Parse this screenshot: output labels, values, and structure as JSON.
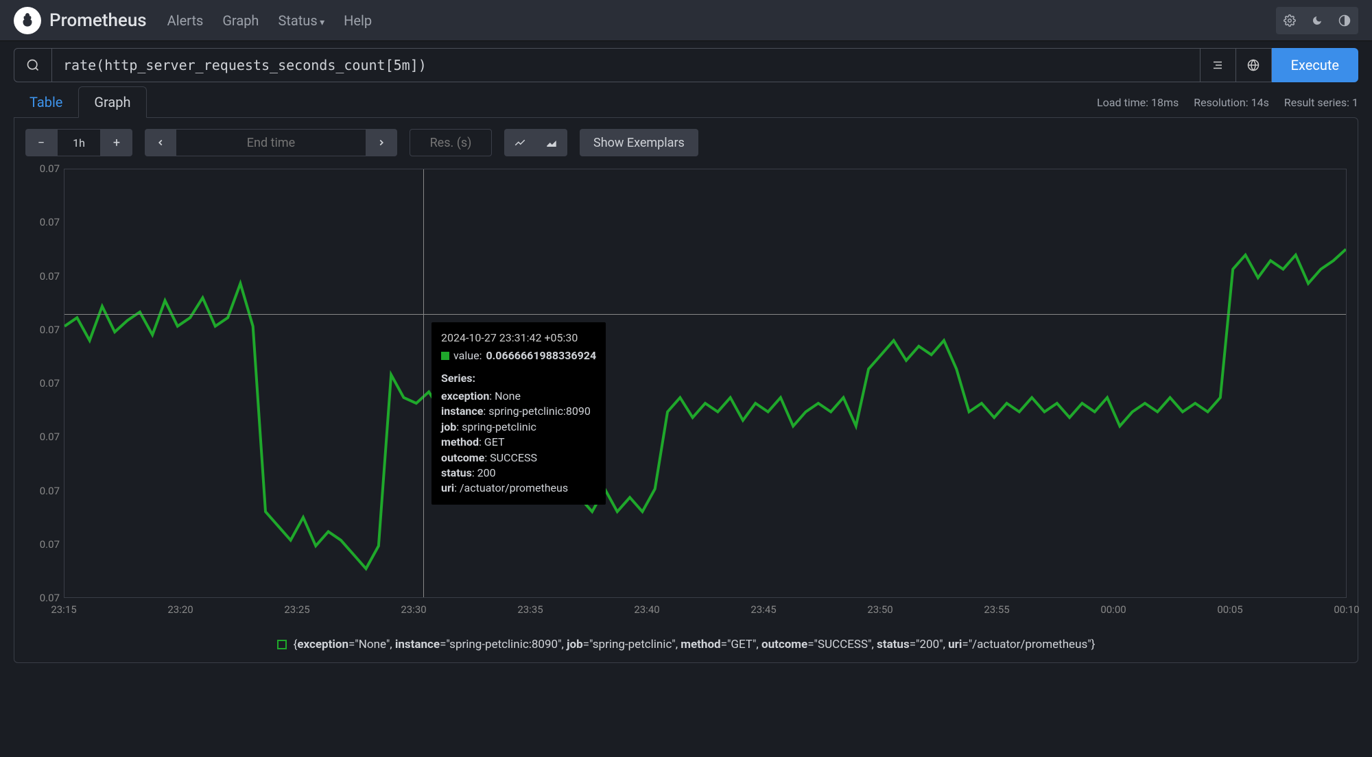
{
  "app": {
    "brand": "Prometheus",
    "nav": [
      "Alerts",
      "Graph",
      "Status",
      "Help"
    ]
  },
  "query": {
    "expression": "rate(http_server_requests_seconds_count[5m])",
    "execute_label": "Execute"
  },
  "stats": {
    "load_time": "Load time: 18ms",
    "resolution": "Resolution: 14s",
    "result_series": "Result series: 1"
  },
  "tabs": {
    "table": "Table",
    "graph": "Graph"
  },
  "toolbar": {
    "range": "1h",
    "endtime_placeholder": "End time",
    "res_placeholder": "Res. (s)",
    "show_exemplars": "Show Exemplars"
  },
  "chart_data": {
    "type": "line",
    "title": "",
    "xlabel": "",
    "ylabel": "",
    "ylim": [
      0.06,
      0.075
    ],
    "y_ticks": [
      "0.07",
      "0.07",
      "0.07",
      "0.07",
      "0.07",
      "0.07",
      "0.07",
      "0.07",
      "0.07"
    ],
    "x_ticks": [
      "23:15",
      "23:20",
      "23:25",
      "23:30",
      "23:35",
      "23:40",
      "23:45",
      "23:50",
      "23:55",
      "00:00",
      "00:05",
      "00:10"
    ],
    "series": [
      {
        "name": "{exception=\"None\", instance=\"spring-petclinic:8090\", job=\"spring-petclinic\", method=\"GET\", outcome=\"SUCCESS\", status=\"200\", uri=\"/actuator/prometheus\"}",
        "color": "#1fa82b",
        "values": [
          0.0695,
          0.0698,
          0.069,
          0.0702,
          0.0693,
          0.0697,
          0.07,
          0.0692,
          0.0704,
          0.0695,
          0.0698,
          0.0705,
          0.0695,
          0.0698,
          0.071,
          0.0695,
          0.063,
          0.0625,
          0.062,
          0.0628,
          0.0618,
          0.0623,
          0.062,
          0.0615,
          0.061,
          0.0618,
          0.0678,
          0.067,
          0.0668,
          0.0672,
          0.0665,
          0.067,
          0.0668,
          0.0665,
          0.067,
          0.066,
          0.0665,
          0.0668,
          0.066,
          0.0665,
          0.0655,
          0.0635,
          0.063,
          0.0638,
          0.063,
          0.0635,
          0.063,
          0.0638,
          0.0665,
          0.067,
          0.0663,
          0.0668,
          0.0665,
          0.067,
          0.0662,
          0.0668,
          0.0665,
          0.067,
          0.066,
          0.0665,
          0.0668,
          0.0665,
          0.067,
          0.066,
          0.068,
          0.0685,
          0.069,
          0.0683,
          0.0688,
          0.0685,
          0.069,
          0.068,
          0.0665,
          0.0668,
          0.0663,
          0.0668,
          0.0665,
          0.067,
          0.0665,
          0.0668,
          0.0663,
          0.0668,
          0.0665,
          0.067,
          0.066,
          0.0665,
          0.0668,
          0.0665,
          0.067,
          0.0665,
          0.0668,
          0.0665,
          0.067,
          0.0715,
          0.072,
          0.0712,
          0.0718,
          0.0715,
          0.072,
          0.071,
          0.0715,
          0.0718,
          0.0722
        ]
      }
    ],
    "crosshair": {
      "x_fraction": 0.28,
      "y_fraction": 0.338
    }
  },
  "tooltip": {
    "timestamp": "2024-10-27 23:31:42 +05:30",
    "value_label": "value:",
    "value": "0.0666661988336924",
    "series_header": "Series:",
    "labels": [
      {
        "k": "exception",
        "v": "None"
      },
      {
        "k": "instance",
        "v": "spring-petclinic:8090"
      },
      {
        "k": "job",
        "v": "spring-petclinic"
      },
      {
        "k": "method",
        "v": "GET"
      },
      {
        "k": "outcome",
        "v": "SUCCESS"
      },
      {
        "k": "status",
        "v": "200"
      },
      {
        "k": "uri",
        "v": "/actuator/prometheus"
      }
    ]
  },
  "legend": {
    "parts": [
      {
        "k": "exception",
        "v": "\"None\""
      },
      {
        "k": "instance",
        "v": "\"spring-petclinic:8090\""
      },
      {
        "k": "job",
        "v": "\"spring-petclinic\""
      },
      {
        "k": "method",
        "v": "\"GET\""
      },
      {
        "k": "outcome",
        "v": "\"SUCCESS\""
      },
      {
        "k": "status",
        "v": "\"200\""
      },
      {
        "k": "uri",
        "v": "\"/actuator/prometheus\""
      }
    ]
  }
}
